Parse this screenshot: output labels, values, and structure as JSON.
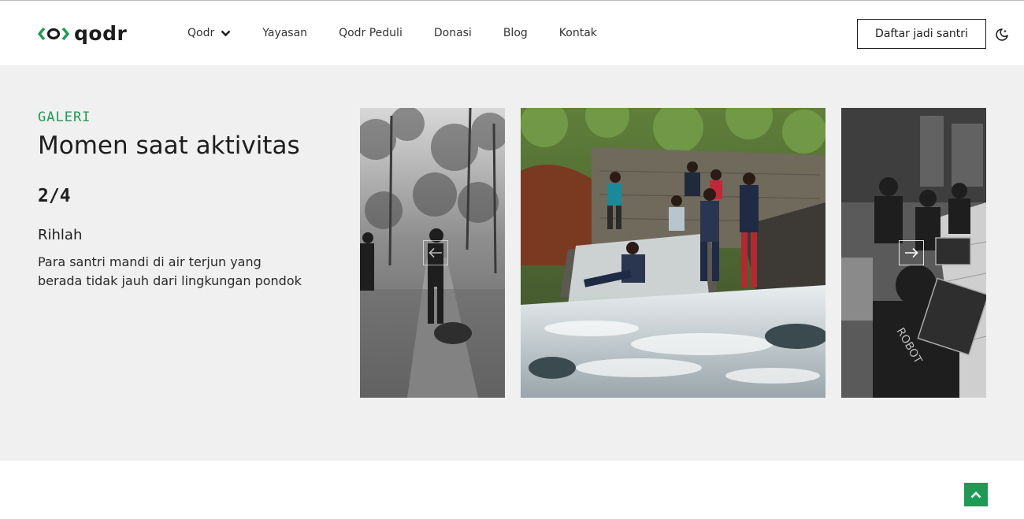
{
  "colors": {
    "brand_green": "#1f9a55",
    "gallery_bg": "#f0f0f0",
    "text_dark": "#1e1e1e"
  },
  "header": {
    "logo_icon": "qodr-logo-mark",
    "logo_text": "qodr",
    "nav": [
      {
        "label": "Qodr",
        "has_dropdown": true
      },
      {
        "label": "Yayasan"
      },
      {
        "label": "Qodr Peduli"
      },
      {
        "label": "Donasi"
      },
      {
        "label": "Blog"
      },
      {
        "label": "Kontak"
      }
    ],
    "cta_label": "Daftar jadi santri",
    "theme_icon": "moon-icon"
  },
  "gallery": {
    "eyebrow": "GALERI",
    "title": "Momen saat aktivitas",
    "counter": "2/4",
    "item_title": "Rihlah",
    "item_desc": "Para santri mandi di air terjun yang berada tidak jauh dari lingkungan pondok",
    "slides": [
      {
        "name": "photo-gardening",
        "style": "grayscale"
      },
      {
        "name": "photo-waterfall",
        "style": "color"
      },
      {
        "name": "photo-laptops",
        "style": "grayscale"
      }
    ],
    "prev_icon": "arrow-left-icon",
    "next_icon": "arrow-right-icon"
  },
  "scroll_top_icon": "chevron-up-icon"
}
